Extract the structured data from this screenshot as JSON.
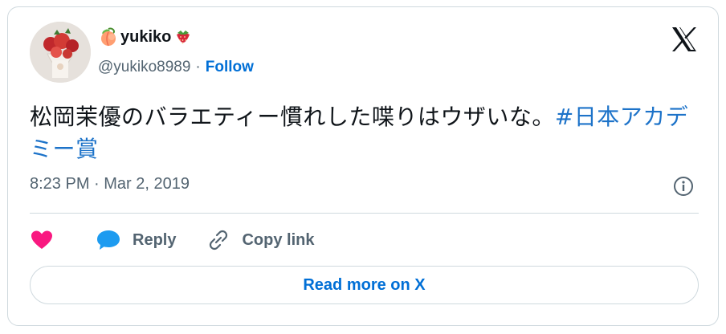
{
  "author": {
    "name": "yukiko",
    "name_prefix_emoji": "peach-emoji",
    "name_suffix_emoji": "strawberry-emoji",
    "handle": "@yukiko8989",
    "separator": "·",
    "follow_label": "Follow",
    "avatar_icon": "strawberry-parfait-avatar"
  },
  "tweet": {
    "text": "松岡茉優のバラエティー慣れした喋りはウザいな。",
    "hashtag": "#日本アカデミー賞"
  },
  "meta": {
    "timestamp": "8:23 PM · Mar 2, 2019"
  },
  "actions": {
    "like_icon": "heart-icon",
    "reply_label": "Reply",
    "copy_label": "Copy link"
  },
  "footer": {
    "read_more_label": "Read more on X"
  },
  "colors": {
    "link": "#006fd6",
    "hashtag": "#1d73c9",
    "heart": "#f91880",
    "reply": "#1d9bf0",
    "muted": "#536471",
    "border": "#cfd9de"
  }
}
